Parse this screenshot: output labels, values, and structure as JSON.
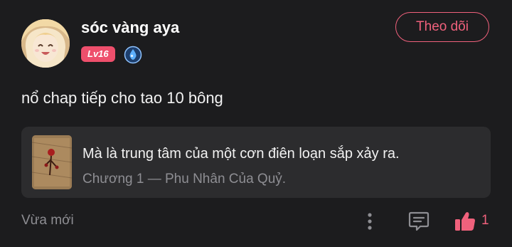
{
  "comment": {
    "author": {
      "name": "sóc vàng aya",
      "level": "Lv16",
      "avatar_icon": "anime-girl-avatar",
      "verify_icon": "water-drop-badge-icon"
    },
    "follow_label": "Theo dõi",
    "text": "nổ chap tiếp cho tao 10 bông",
    "chapter_card": {
      "quote": "Mà là trung tâm của một cơn điên loạn sắp xảy ra.",
      "meta": "Chương 1 — Phu Nhân Của Quỷ.",
      "thumbnail_icon": "book-cover-thumbnail"
    },
    "timestamp": "Vừa mới",
    "actions": {
      "more_icon": "vertical-dots-icon",
      "reply_icon": "message-icon",
      "like_icon": "thumbs-up-icon",
      "like_count": "1"
    }
  },
  "colors": {
    "background": "#1c1c1e",
    "card": "#2c2c2e",
    "accent": "#f0617c",
    "badge": "#ee4f6c",
    "muted": "#8e8e93"
  }
}
